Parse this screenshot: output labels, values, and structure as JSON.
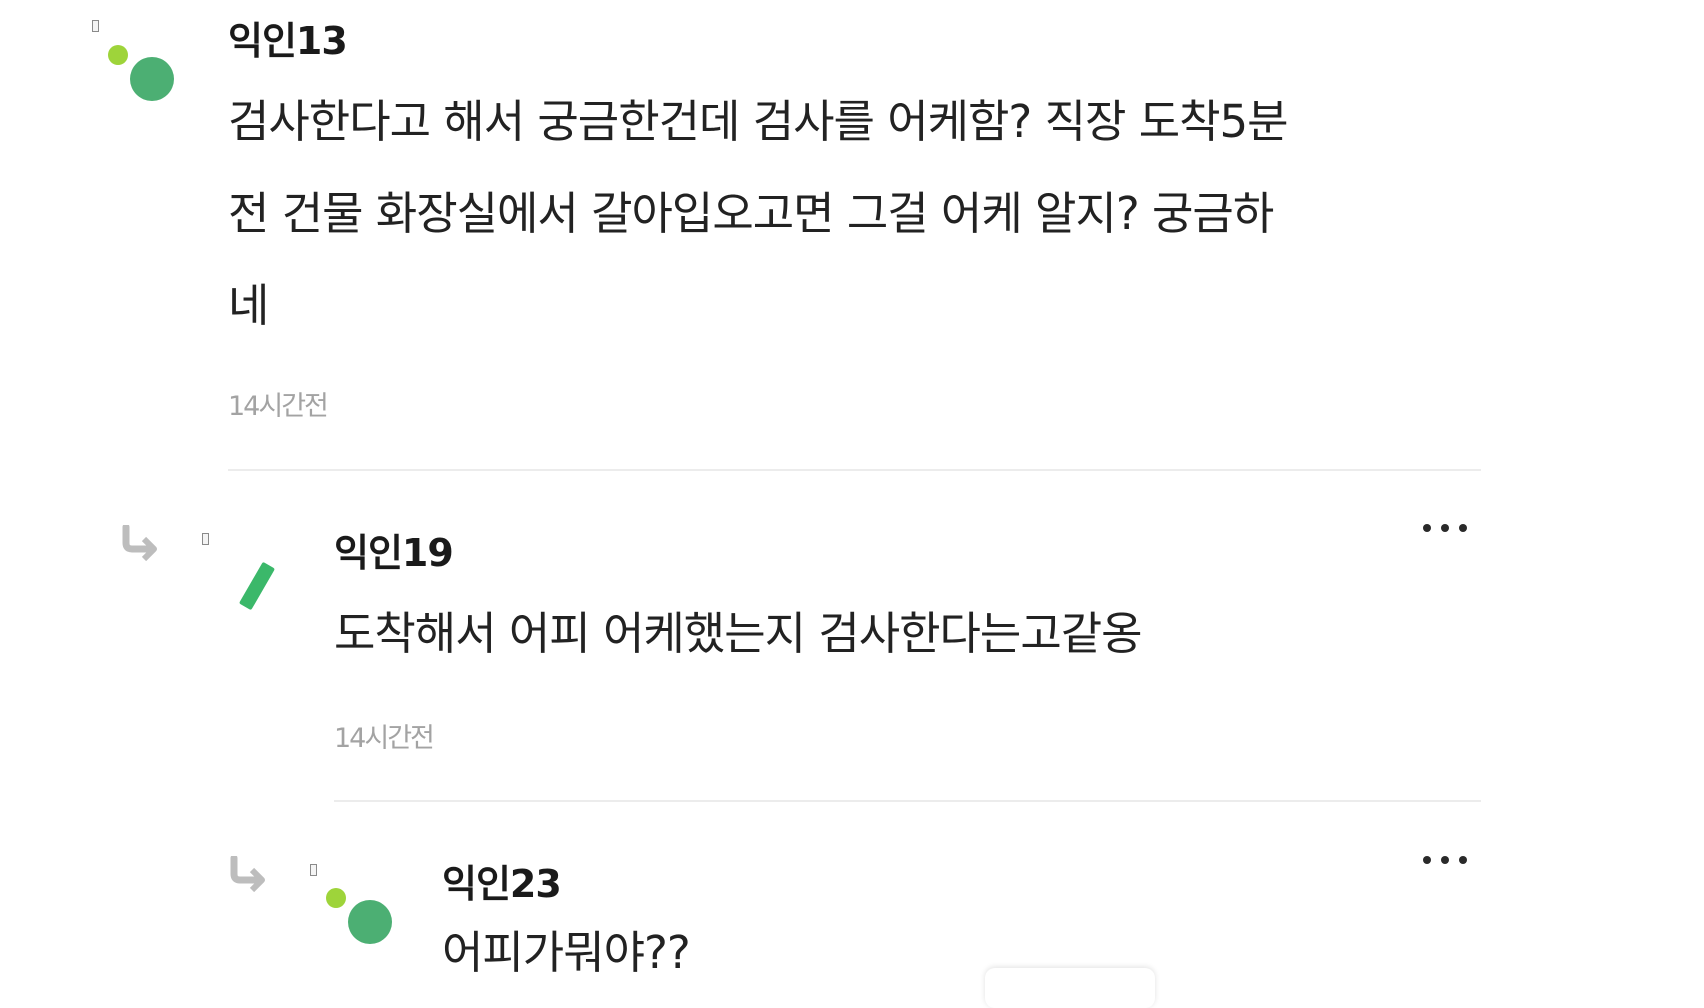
{
  "comments": [
    {
      "author": "익인13",
      "body_lines": [
        "검사한다고 해서 궁금한건데 검사를 어케함? 직장 도착5분",
        "전 건물 화장실에서 갈아입오고면 그걸 어케 알지? 궁금하",
        "네"
      ],
      "time": "14시간전"
    },
    {
      "author": "익인19",
      "body_lines": [
        "도착해서 어피 어케했는지 검사한다는고같옹"
      ],
      "time": "14시간전"
    },
    {
      "author": "익인23",
      "body_lines": [
        "어피가뭐야??"
      ]
    }
  ],
  "icons": {
    "more": "more-dots-icon",
    "reply": "reply-arrow-icon",
    "avatar_dots": "avatar-dots-icon",
    "avatar_slash": "avatar-slash-icon"
  },
  "colors": {
    "avatar_green": "#4caf73",
    "avatar_lime": "#9ed43a",
    "slash_green": "#3bb86a",
    "time_gray": "#a3a3a3",
    "divider": "#ececec"
  }
}
